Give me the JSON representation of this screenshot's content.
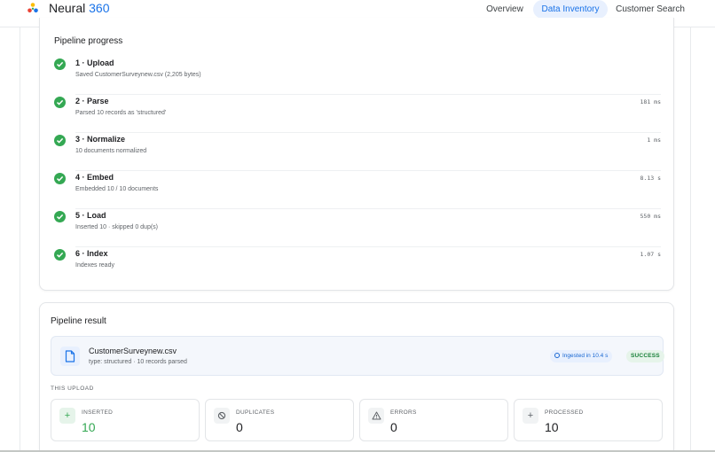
{
  "header": {
    "brand_name": "Neural",
    "brand_suffix": "360",
    "nav": [
      "Overview",
      "Data Inventory",
      "Customer Search"
    ],
    "active_nav": "Data Inventory"
  },
  "progress": {
    "title": "Pipeline progress",
    "steps": [
      {
        "title": "1 · Upload",
        "detail": "Saved CustomerSurveynew.csv (2,205 bytes)",
        "time": ""
      },
      {
        "title": "2 · Parse",
        "detail": "Parsed 10 records as 'structured'",
        "time": "181 ms"
      },
      {
        "title": "3 · Normalize",
        "detail": "10 documents normalized",
        "time": "1 ms"
      },
      {
        "title": "4 · Embed",
        "detail": "Embedded 10 / 10 documents",
        "time": "8.13 s"
      },
      {
        "title": "5 · Load",
        "detail": "Inserted 10 · skipped 0 dup(s)",
        "time": "550 ms"
      },
      {
        "title": "6 · Index",
        "detail": "Indexes ready",
        "time": "1.07 s"
      }
    ]
  },
  "result": {
    "title": "Pipeline result",
    "file_name": "CustomerSurveynew.csv",
    "file_meta": "type: structured · 10 records parsed",
    "ingested": "Ingested in 10.4 s",
    "status": "SUCCESS",
    "section_label": "THIS UPLOAD",
    "stats": [
      {
        "label": "INSERTED",
        "value": "10",
        "icon": "plus-icon"
      },
      {
        "label": "DUPLICATES",
        "value": "0",
        "icon": "block-icon"
      },
      {
        "label": "ERRORS",
        "value": "0",
        "icon": "warning-icon"
      },
      {
        "label": "PROCESSED",
        "value": "10",
        "icon": "plus-icon"
      }
    ]
  },
  "colors": {
    "accent": "#1a73e8",
    "success": "#34a853",
    "nav_active_bg": "#e8f0fe"
  }
}
